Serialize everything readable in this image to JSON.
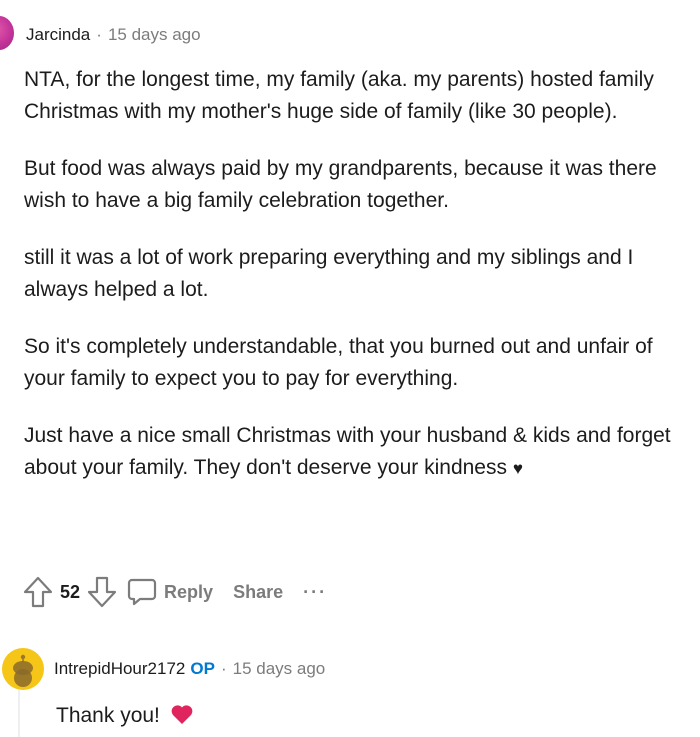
{
  "comment1": {
    "author": "Jarcinda",
    "separator": "·",
    "time": "15 days ago",
    "paragraphs": [
      "NTA, for the longest time, my family (aka. my parents) hosted family Christmas with my mother's huge side of family (like 30 people).",
      "But food was always paid by my grandparents, because it was there wish to have a big family celebration together.",
      "still it was a lot of work preparing everything and my siblings and I always helped a lot.",
      "So it's completely understandable, that you burned out and unfair of your family to expect you to pay for everything.",
      "Just have a nice small Christmas with your husband & kids and forget about your family. They don't deserve your kindness"
    ],
    "heart": "♥",
    "actions": {
      "vote_count": "52",
      "reply_label": "Reply",
      "share_label": "Share",
      "more_label": "···"
    }
  },
  "comment2": {
    "author": "IntrepidHour2172",
    "op_label": "OP",
    "separator": "·",
    "time": "15 days ago",
    "text": "Thank you!"
  },
  "colors": {
    "text": "#1c1c1c",
    "muted": "#7c7c7c",
    "op_blue": "#0079d3",
    "heart_red": "#e0245e",
    "avatar_yellow": "#f5c518"
  }
}
